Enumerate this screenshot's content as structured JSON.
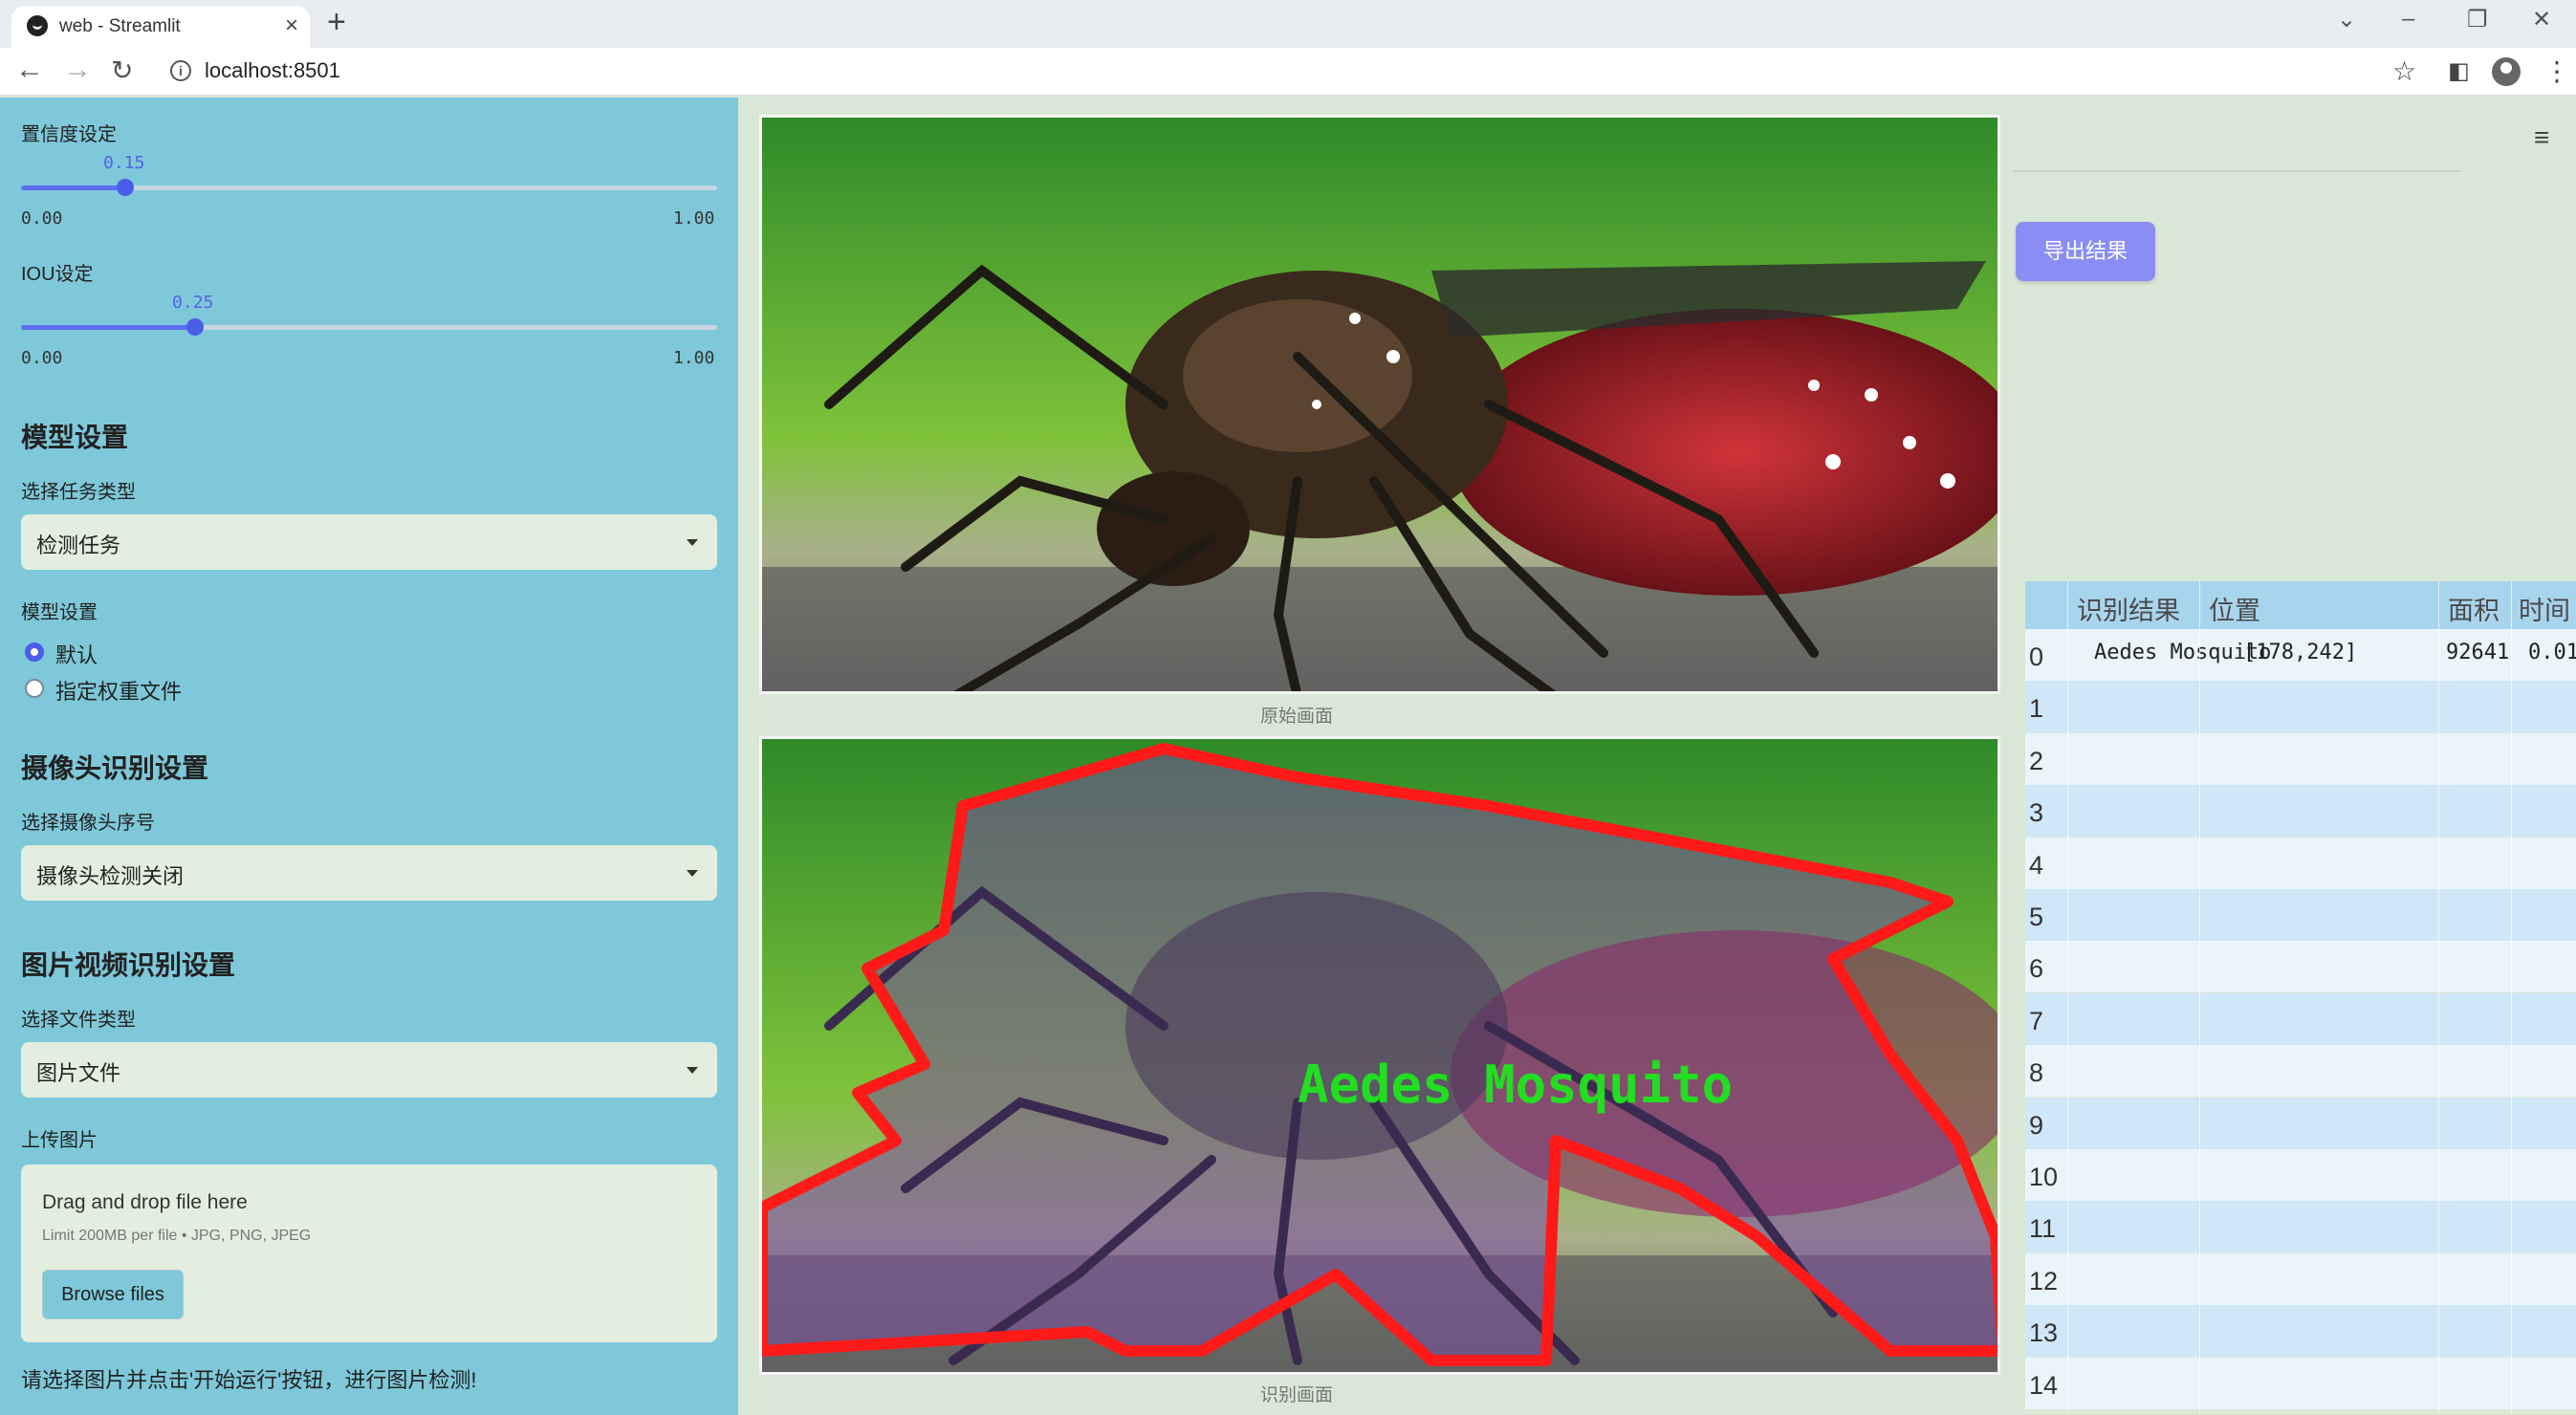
{
  "browser": {
    "tab_title": "web - Streamlit",
    "url": "localhost:8501"
  },
  "sidebar": {
    "confidence": {
      "label": "置信度设定",
      "value": "0.15",
      "value_num": 0.15,
      "min": "0.00",
      "max": "1.00"
    },
    "iou": {
      "label": "IOU设定",
      "value": "0.25",
      "value_num": 0.25,
      "min": "0.00",
      "max": "1.00"
    },
    "model_section": {
      "title": "模型设置",
      "task_label": "选择任务类型",
      "task_value": "检测任务",
      "model_label": "模型设置",
      "radio_default": "默认",
      "radio_custom": "指定权重文件",
      "selected": "默认"
    },
    "camera_section": {
      "title": "摄像头识别设置",
      "camera_label": "选择摄像头序号",
      "camera_value": "摄像头检测关闭"
    },
    "file_section": {
      "title": "图片视频识别设置",
      "type_label": "选择文件类型",
      "type_value": "图片文件",
      "upload_label": "上传图片",
      "drop_text": "Drag and drop file here",
      "limit_text": "Limit 200MB per file • JPG, PNG, JPEG",
      "browse_label": "Browse files"
    },
    "hint": "请选择图片并点击'开始运行'按钮，进行图片检测!"
  },
  "main": {
    "original_caption": "原始画面",
    "result_caption": "识别画面",
    "detection_label": "Aedes Mosquito"
  },
  "right_panel": {
    "export_label": "导出结果",
    "table": {
      "headers": [
        "识别结果",
        "位置",
        "面积",
        "时间"
      ],
      "rows": [
        {
          "idx": "0",
          "result": "Aedes Mosquito",
          "position": "[178,242]",
          "area": "92641",
          "time": "0.01"
        },
        {
          "idx": "1"
        },
        {
          "idx": "2"
        },
        {
          "idx": "3"
        },
        {
          "idx": "4"
        },
        {
          "idx": "5"
        },
        {
          "idx": "6"
        },
        {
          "idx": "7"
        },
        {
          "idx": "8"
        },
        {
          "idx": "9"
        },
        {
          "idx": "10"
        },
        {
          "idx": "11"
        },
        {
          "idx": "12"
        },
        {
          "idx": "13"
        },
        {
          "idx": "14"
        }
      ]
    }
  },
  "colors": {
    "sidebar_bg": "#7ec8da",
    "accent": "#4a5de8",
    "export_btn": "#8a8ef4",
    "detect_outline": "#ff1a1a",
    "detect_text": "#22dd22"
  }
}
